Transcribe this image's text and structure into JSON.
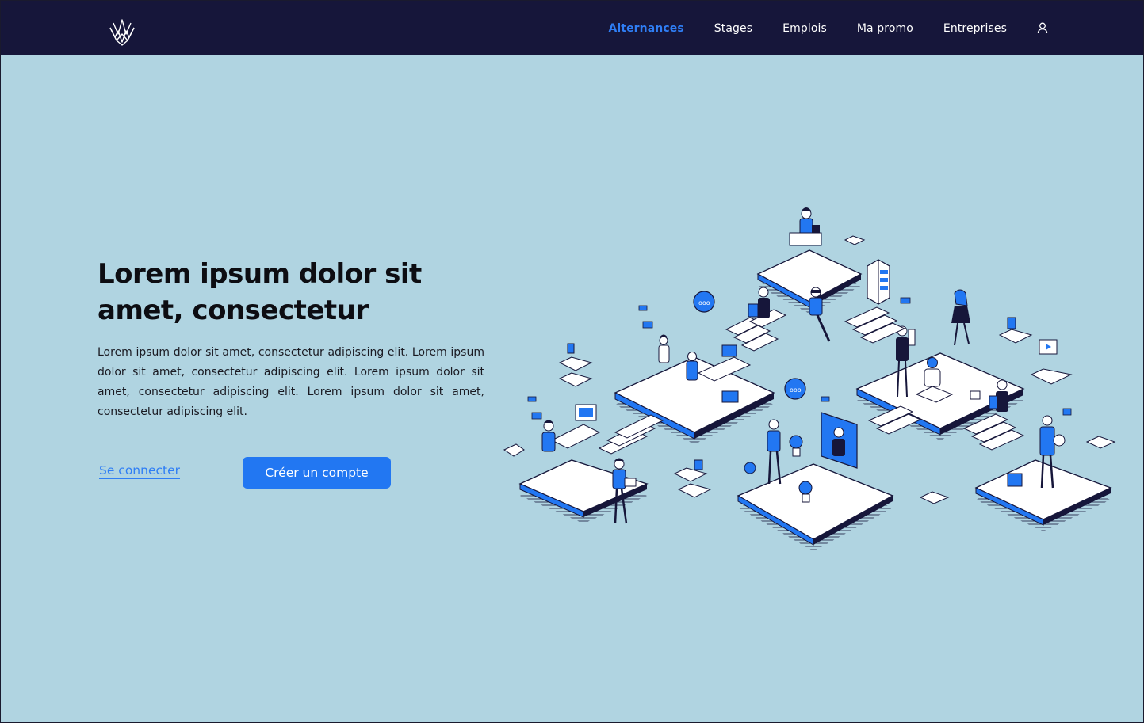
{
  "navbar": {
    "logo_icon": "crown-logo-icon",
    "links": [
      {
        "label": "Alternances",
        "active": true
      },
      {
        "label": "Stages",
        "active": false
      },
      {
        "label": "Emplois",
        "active": false
      },
      {
        "label": "Ma promo",
        "active": false
      },
      {
        "label": "Entreprises",
        "active": false
      }
    ],
    "user_icon": "user-icon"
  },
  "hero": {
    "title": "Lorem ipsum dolor sit amet, consectetur",
    "text": "Lorem ipsum dolor sit amet, consectetur adipiscing elit. Lorem ipsum dolor sit amet, consectetur adipiscing elit. Lorem ipsum dolor sit amet, consectetur adipiscing elit. Lorem ipsum dolor sit amet, consectetur adipiscing elit.",
    "login_label": "Se connecter",
    "signup_label": "Créer un compte",
    "illustration": "isometric-office-illustration"
  },
  "colors": {
    "navbar_bg": "#16163a",
    "page_bg": "#b0d4e1",
    "accent": "#2277f2",
    "text_dark": "#0d0d12"
  }
}
